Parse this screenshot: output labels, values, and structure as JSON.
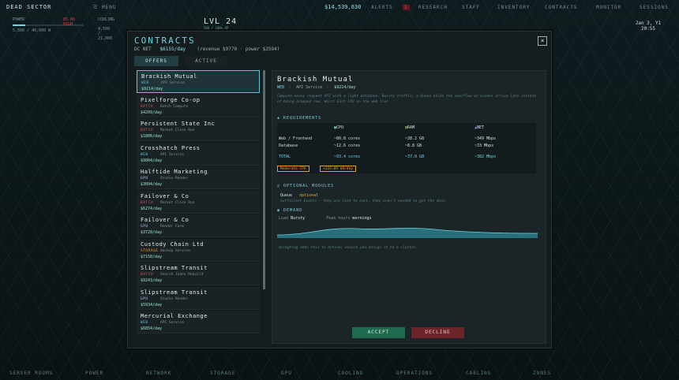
{
  "topbar": {
    "brand": "DEAD SECTOR",
    "menu": "☰ MENU",
    "money": "$14,539,630",
    "items": [
      "ALERTS",
      "RESEARCH",
      "STAFF",
      "INVENTORY",
      "CONTRACTS",
      "MONITOR",
      "SESSIONS"
    ],
    "alert_count": "1"
  },
  "hud": {
    "power": "5,500 / 40,000 W",
    "cooling": "4,500 / 21,000",
    "power_label": "POWER",
    "cooling_label": "COOLING",
    "status": "85.0% HIGH"
  },
  "level": {
    "title": "LVL 24",
    "sub": "500 / 100% XP"
  },
  "clock": {
    "date": "Jan 3, Y1",
    "time": "20:55"
  },
  "modal": {
    "title": "CONTRACTS",
    "net_label": "DC NET",
    "net_value": "$6155/day",
    "net_detail": "(revenue $9770 · power $2594)",
    "tabs": [
      "OFFERS",
      "ACTIVE"
    ],
    "close": "×",
    "offers": [
      {
        "name": "Brackish Mutual",
        "type": "WEB",
        "desc": "API Service",
        "rate": "$9214/day"
      },
      {
        "name": "Pixelforge Co-op",
        "type": "BATCH",
        "desc": "Batch Compute",
        "rate": "$4209/day"
      },
      {
        "name": "Persistent State Inc",
        "type": "BATCH",
        "desc": "Market Close Run",
        "rate": "$1806/day"
      },
      {
        "name": "Crosshatch Press",
        "type": "WEB",
        "desc": "API Service",
        "rate": "$9004/day"
      },
      {
        "name": "Halftide Marketing",
        "type": "GPU",
        "desc": "Studio Render",
        "rate": "$3094/day"
      },
      {
        "name": "Failover & Co",
        "type": "BATCH",
        "desc": "Market Close Run",
        "rate": "$6274/day"
      },
      {
        "name": "Failover & Co",
        "type": "GPU",
        "desc": "Render Farm",
        "rate": "$3728/day"
      },
      {
        "name": "Custody Chain Ltd",
        "type": "STORAGE",
        "desc": "Backup Service",
        "rate": "$7150/day"
      },
      {
        "name": "Slipstream Transit",
        "type": "BATCH",
        "desc": "Search Index Rebuild",
        "rate": "$9243/day"
      },
      {
        "name": "Slipstream Transit",
        "type": "GPU",
        "desc": "Studio Render",
        "rate": "$5934/day"
      },
      {
        "name": "Mercurial Exchange",
        "type": "WEB",
        "desc": "API Service",
        "rate": "$6854/day"
      }
    ],
    "detail": {
      "name": "Brackish Mutual",
      "type": "WEB",
      "service": "API Service",
      "rate": "$9214/day",
      "description": "Compute-heavy request API with a light database. Bursty traffic; a Queue holds the overflow on wishes arrive late instead of being dropped now. Worst East CPU on the web tier.",
      "requirements_label": "REQUIREMENTS",
      "cols": [
        "CPU",
        "RAM",
        "NET"
      ],
      "rows": [
        {
          "name": "Web / Frontend",
          "cpu": "~80.8 cores",
          "ram": "~28.2 GB",
          "net": "~349 Mbps"
        },
        {
          "name": "Database",
          "cpu": "~12.6 cores",
          "ram": "~8.8 GB",
          "net": "~33 Mbps"
        }
      ],
      "total": {
        "name": "TOTAL",
        "cpu": "~93.4 cores",
        "ram": "~37.0 GB",
        "net": "~382 Mbps"
      },
      "badges": [
        "Moderate CPU",
        "+233.09 $8/day"
      ],
      "optional_label": "OPTIONAL MODULES",
      "module_name": "Queue",
      "module_state": "optional",
      "module_desc": "Sufficient Events · they are late to cost, they aren't needed to get the deal.",
      "demand_label": "DEMAND",
      "demand_load_label": "Load",
      "demand_load": "Bursty",
      "demand_peak_label": "Peak hours",
      "demand_peak": "mornings",
      "note": "Accepting adds this to Active; ensure you assign it to a cluster."
    },
    "accept": "ACCEPT",
    "decline": "DECLINE"
  },
  "bottombar": [
    "SERVER ROOMS",
    "POWER",
    "NETWORK",
    "STORAGE",
    "GPU",
    "COOLING",
    "OPERATIONS",
    "CABLING",
    "ZONES"
  ]
}
